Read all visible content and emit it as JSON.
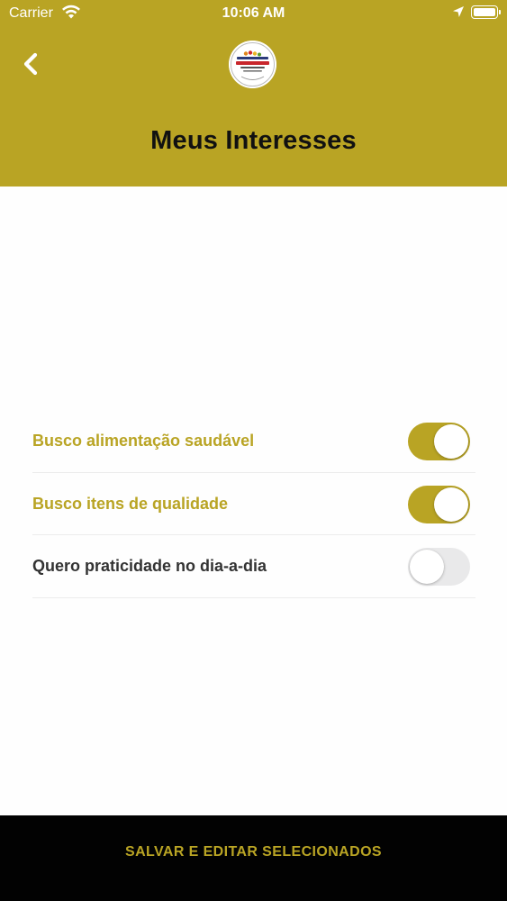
{
  "status_bar": {
    "carrier": "Carrier",
    "time": "10:06 AM",
    "icons": [
      "wifi-icon",
      "location-arrow-icon",
      "battery-icon"
    ]
  },
  "header": {
    "title": "Meus Interesses",
    "back_icon": "chevron-left-icon",
    "background_color": "#b9a424"
  },
  "interests": [
    {
      "label": "Busco alimentação saudável",
      "enabled": true
    },
    {
      "label": "Busco itens de qualidade",
      "enabled": true
    },
    {
      "label": "Quero praticidade no dia-a-dia",
      "enabled": false
    }
  ],
  "footer": {
    "save_label": "SALVAR E EDITAR SELECIONADOS"
  },
  "colors": {
    "accent": "#b9a424",
    "toggle_off": "#e9e9ea",
    "footer_bg": "#020202",
    "label_off": "#333333"
  }
}
